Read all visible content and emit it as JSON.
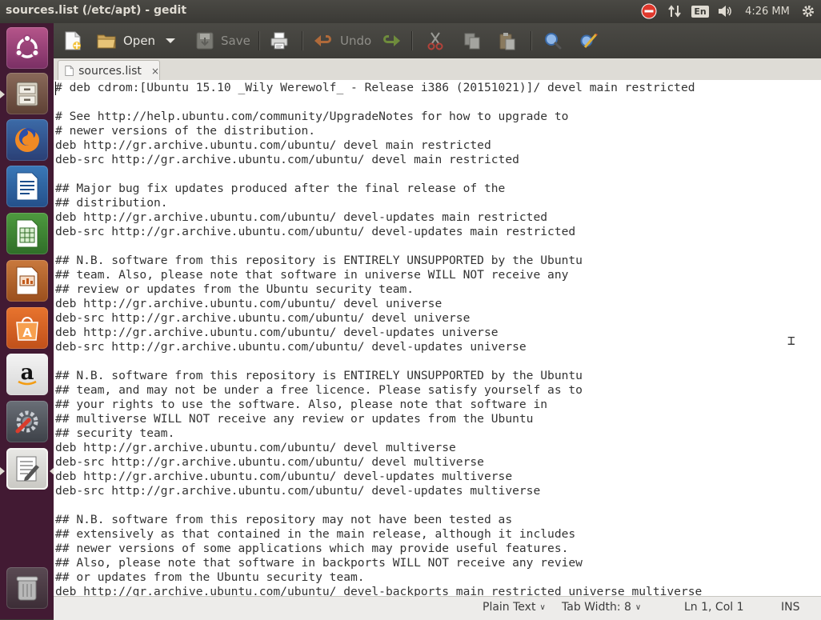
{
  "window": {
    "title": "sources.list (/etc/apt) - gedit"
  },
  "tray": {
    "lang": "En",
    "clock": "4:26 MM"
  },
  "toolbar": {
    "open_label": "Open",
    "save_label": "Save",
    "undo_label": "Undo"
  },
  "tab": {
    "label": "sources.list",
    "close": "×"
  },
  "editor": {
    "lines": [
      "# deb cdrom:[Ubuntu 15.10 _Wily Werewolf_ - Release i386 (20151021)]/ devel main restricted",
      "",
      "# See http://help.ubuntu.com/community/UpgradeNotes for how to upgrade to",
      "# newer versions of the distribution.",
      "deb http://gr.archive.ubuntu.com/ubuntu/ devel main restricted",
      "deb-src http://gr.archive.ubuntu.com/ubuntu/ devel main restricted",
      "",
      "## Major bug fix updates produced after the final release of the",
      "## distribution.",
      "deb http://gr.archive.ubuntu.com/ubuntu/ devel-updates main restricted",
      "deb-src http://gr.archive.ubuntu.com/ubuntu/ devel-updates main restricted",
      "",
      "## N.B. software from this repository is ENTIRELY UNSUPPORTED by the Ubuntu",
      "## team. Also, please note that software in universe WILL NOT receive any",
      "## review or updates from the Ubuntu security team.",
      "deb http://gr.archive.ubuntu.com/ubuntu/ devel universe",
      "deb-src http://gr.archive.ubuntu.com/ubuntu/ devel universe",
      "deb http://gr.archive.ubuntu.com/ubuntu/ devel-updates universe",
      "deb-src http://gr.archive.ubuntu.com/ubuntu/ devel-updates universe",
      "",
      "## N.B. software from this repository is ENTIRELY UNSUPPORTED by the Ubuntu",
      "## team, and may not be under a free licence. Please satisfy yourself as to",
      "## your rights to use the software. Also, please note that software in",
      "## multiverse WILL NOT receive any review or updates from the Ubuntu",
      "## security team.",
      "deb http://gr.archive.ubuntu.com/ubuntu/ devel multiverse",
      "deb-src http://gr.archive.ubuntu.com/ubuntu/ devel multiverse",
      "deb http://gr.archive.ubuntu.com/ubuntu/ devel-updates multiverse",
      "deb-src http://gr.archive.ubuntu.com/ubuntu/ devel-updates multiverse",
      "",
      "## N.B. software from this repository may not have been tested as",
      "## extensively as that contained in the main release, although it includes",
      "## newer versions of some applications which may provide useful features.",
      "## Also, please note that software in backports WILL NOT receive any review",
      "## or updates from the Ubuntu security team.",
      "deb http://gr.archive.ubuntu.com/ubuntu/ devel-backports main restricted universe multiverse"
    ]
  },
  "statusbar": {
    "language": "Plain Text",
    "tab_width": "Tab Width: 8",
    "position": "Ln 1, Col 1",
    "mode": "INS"
  },
  "launcher": {
    "items": [
      "dash-home",
      "files",
      "firefox",
      "libreoffice-writer",
      "libreoffice-calc",
      "libreoffice-impress",
      "software-center",
      "amazon",
      "system-settings",
      "text-editor",
      "trash"
    ]
  },
  "colors": {
    "launcher_bg": "#421a33",
    "panel_bg": "#3c3b37",
    "accent": "#dd4814"
  }
}
